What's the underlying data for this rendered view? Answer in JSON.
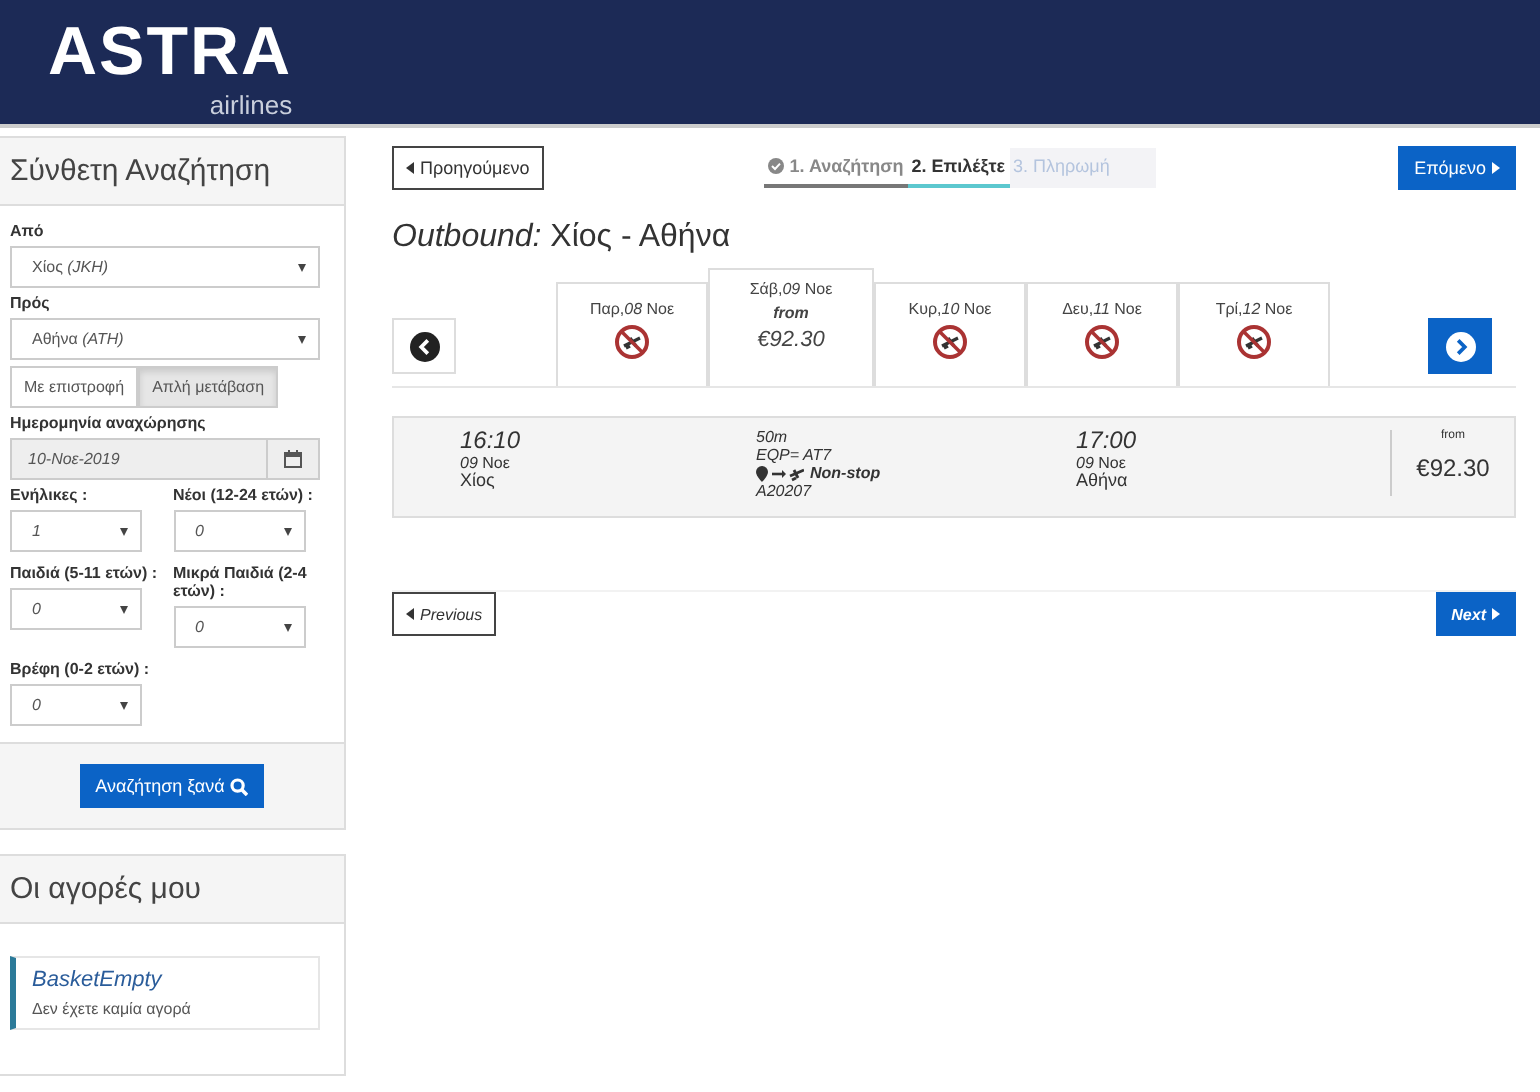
{
  "header": {
    "logo": "ASTRA",
    "logo_sub": "airlines"
  },
  "search_panel": {
    "title": "Σύνθετη Αναζήτηση",
    "from": {
      "label": "Από",
      "value": "Χίος *(JKH)*"
    },
    "to": {
      "label": "Πρός",
      "value": "Αθήνα *(ATH)*"
    },
    "trip_types": [
      {
        "label": "Με επιστροφή",
        "selected": false
      },
      {
        "label": "Απλή μετάβαση",
        "selected": true
      }
    ],
    "date": {
      "label": "Ημερομηνία αναχώρησης",
      "value": "10-Νοε-2019"
    },
    "passengers": [
      {
        "label": "Ενήλικες :",
        "value": "1"
      },
      {
        "label": "Νέοι (12-24 ετών) :",
        "value": "0"
      },
      {
        "label": "Παιδιά (5-11 ετών) :",
        "value": "0"
      },
      {
        "label": "Μικρά Παιδιά (2-4 ετών) :",
        "value": "0"
      },
      {
        "label": "Βρέφη (0-2 ετών) :",
        "value": "0"
      }
    ],
    "search_button": "Αναζήτηση ξανά"
  },
  "basket": {
    "title": "Οι αγορές μου",
    "item_title": "BasketEmpty",
    "item_text": "Δεν έχετε καμία αγορά"
  },
  "top_nav": {
    "previous": "Προηγούμενο",
    "next": "Επόμενο",
    "steps": [
      {
        "label": "1. Αναζήτηση",
        "kind": "done"
      },
      {
        "label": "2. Επιλέξτε",
        "kind": "current"
      },
      {
        "label": "3. Πληρωμή",
        "kind": "todo"
      }
    ]
  },
  "heading": "*Outbound:* Χίος - Αθήνα",
  "days": [
    {
      "label": "Παρ,*08* Νοε",
      "selected": false,
      "available": false
    },
    {
      "label": "Σάβ,*09* Νοε",
      "selected": true,
      "available": true,
      "from": "from",
      "price": "€92.30"
    },
    {
      "label": "Κυρ,*10* Νοε",
      "selected": false,
      "available": false
    },
    {
      "label": "Δευ,*11* Νοε",
      "selected": false,
      "available": false
    },
    {
      "label": "Τρί,*12* Νοε",
      "selected": false,
      "available": false
    }
  ],
  "flight": {
    "dep_time": "16:10",
    "dep_date": "*09* Νοε",
    "dep_city": "Χίος",
    "duration": "50m",
    "equipment": "EQP= AT7",
    "stops": "Non-stop",
    "flight_no": "A20207",
    "arr_time": "17:00",
    "arr_date": "*09* Νοε",
    "arr_city": "Αθήνα",
    "from": "from",
    "price": "€92.30"
  },
  "bottom_nav": {
    "previous": "Previous",
    "next": "Next"
  }
}
